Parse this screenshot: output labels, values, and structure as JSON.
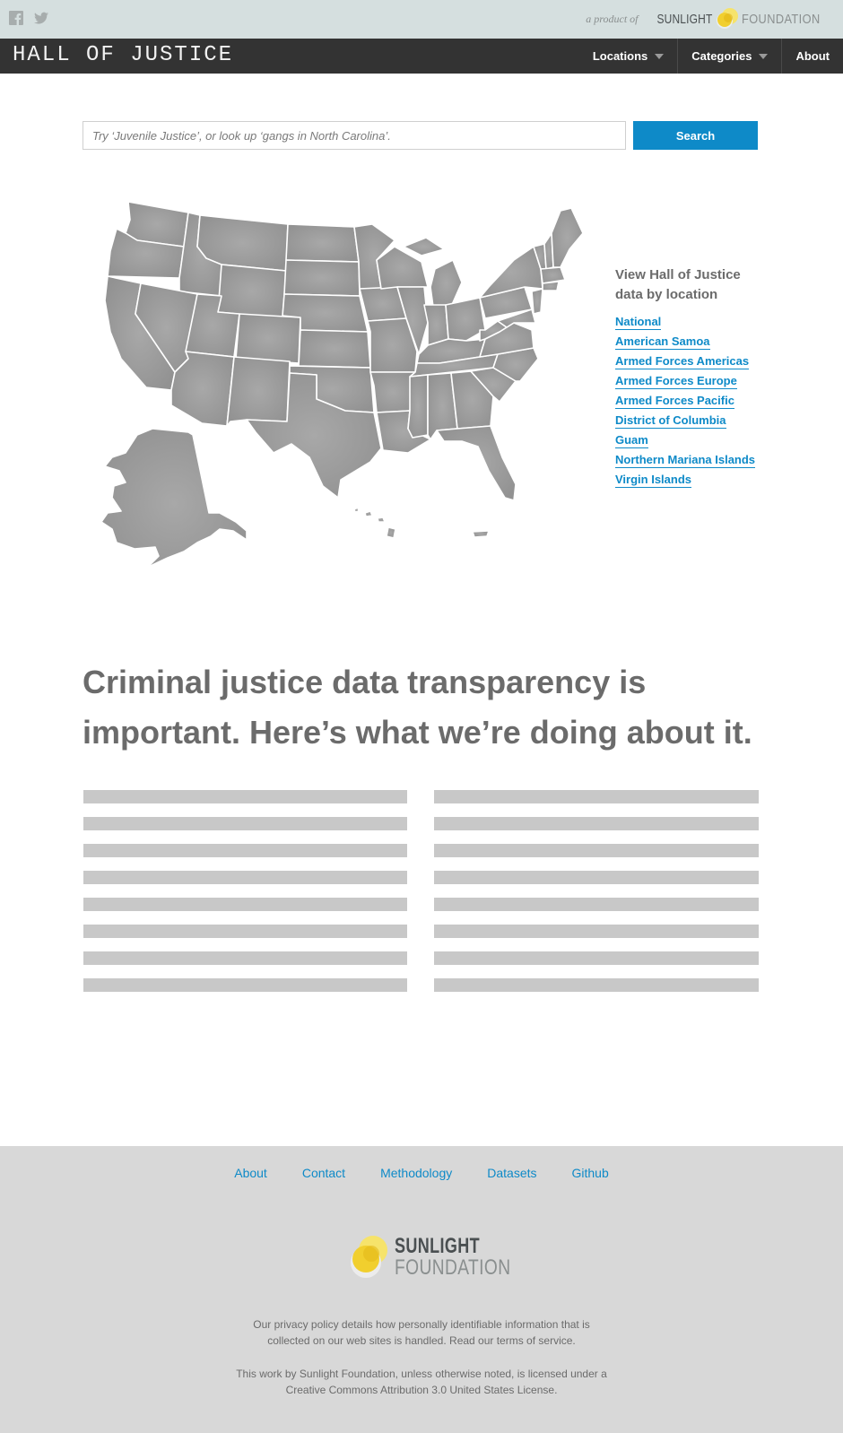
{
  "topbar": {
    "social_icons": [
      "facebook-icon",
      "twitter-icon"
    ],
    "product_prefix": "a product of",
    "brand_part1": "SUNLIGHT",
    "brand_part2": "FOUNDATION"
  },
  "nav": {
    "brand": "HALL OF JUSTICE",
    "items": [
      {
        "label": "Locations",
        "dropdown": true
      },
      {
        "label": "Categories",
        "dropdown": true
      },
      {
        "label": "About",
        "dropdown": false
      }
    ]
  },
  "search": {
    "placeholder": "Try ‘Juvenile Justice’, or look up ‘gangs in North Carolina’.",
    "button_label": "Search"
  },
  "locations": {
    "title": "View Hall of Justice data by location",
    "items": [
      "National",
      "American Samoa",
      "Armed Forces Americas",
      "Armed Forces Europe",
      "Armed Forces Pacific",
      "District of Columbia",
      "Guam",
      "Northern Mariana Islands",
      "Virgin Islands"
    ]
  },
  "headline": "Criminal justice data transparency is important. Here’s what we’re doing about it.",
  "footer": {
    "links": [
      "About",
      "Contact",
      "Methodology",
      "Datasets",
      "Github"
    ],
    "logo_line1": "SUNLIGHT",
    "logo_line2": "FOUNDATION",
    "privacy": "Our privacy policy details how personally identifiable information that is collected on our web sites is handled. Read our terms of service.",
    "license": "This work by Sunlight Foundation, unless otherwise noted, is licensed under a Creative Commons Attribution 3.0 United States License."
  },
  "colors": {
    "accent": "#0e8ac8",
    "nav_bg": "#333333",
    "topbar_bg": "#d5dfdf",
    "footer_bg": "#d8d8d8",
    "map_fill": "#9a9a9a",
    "logo_yellow": "#f1cf2e"
  }
}
